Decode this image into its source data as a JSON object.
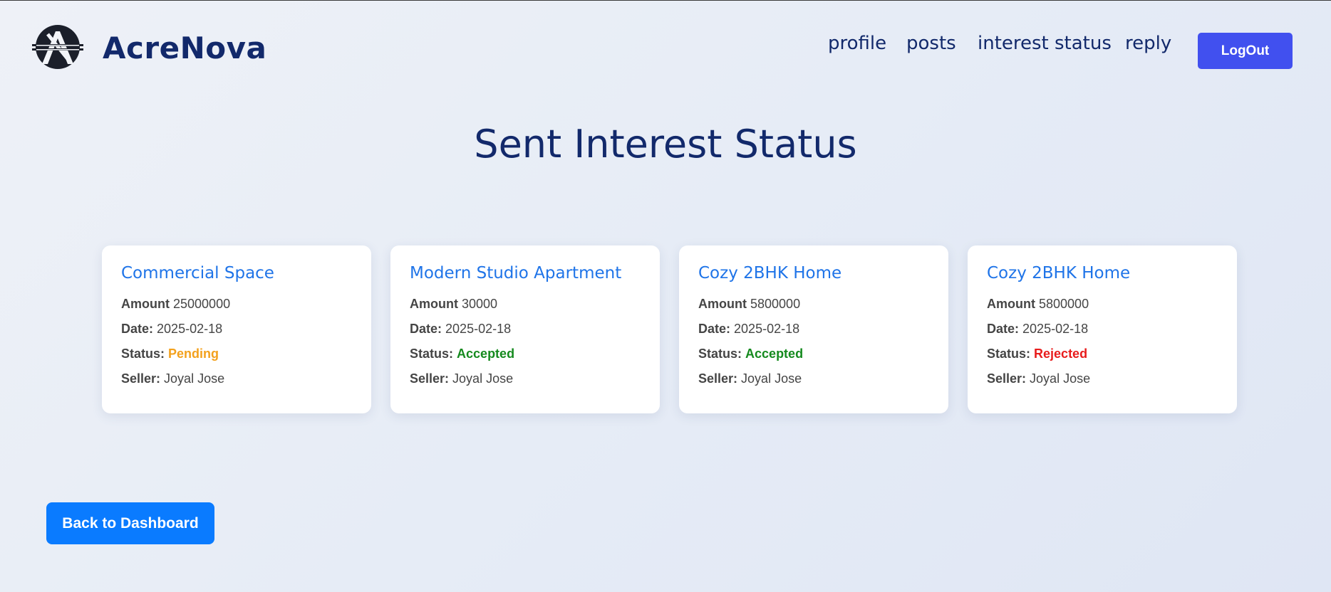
{
  "header": {
    "logo_icon": "acrenova-logo-icon",
    "brand": "AcreNova",
    "nav": [
      {
        "label": "profile"
      },
      {
        "label": "posts"
      },
      {
        "label": "interest status"
      },
      {
        "label": "reply"
      }
    ],
    "logout_label": "LogOut"
  },
  "main": {
    "title": "Sent Interest Status",
    "cards": [
      {
        "title": "Commercial Space",
        "amount_label": "Amount",
        "amount": "25000000",
        "date_label": "Date:",
        "date": "2025-02-18",
        "status_label": "Status:",
        "status": "Pending",
        "seller_label": "Seller:",
        "seller": "Joyal Jose"
      },
      {
        "title": "Modern Studio Apartment",
        "amount_label": "Amount",
        "amount": "30000",
        "date_label": "Date:",
        "date": "2025-02-18",
        "status_label": "Status:",
        "status": "Accepted",
        "seller_label": "Seller:",
        "seller": "Joyal Jose"
      },
      {
        "title": "Cozy 2BHK Home",
        "amount_label": "Amount",
        "amount": "5800000",
        "date_label": "Date:",
        "date": "2025-02-18",
        "status_label": "Status:",
        "status": "Accepted",
        "seller_label": "Seller:",
        "seller": "Joyal Jose"
      },
      {
        "title": "Cozy 2BHK Home",
        "amount_label": "Amount",
        "amount": "5800000",
        "date_label": "Date:",
        "date": "2025-02-18",
        "status_label": "Status:",
        "status": "Rejected",
        "seller_label": "Seller:",
        "seller": "Joyal Jose"
      }
    ],
    "back_label": "Back to Dashboard"
  },
  "colors": {
    "brand": "#12296b",
    "logout_button": "#4150ef",
    "back_button": "#0a7bff",
    "card_title": "#1f74e8",
    "status_pending": "#f3a11d",
    "status_accepted": "#158a1e",
    "status_rejected": "#e81c1c"
  }
}
